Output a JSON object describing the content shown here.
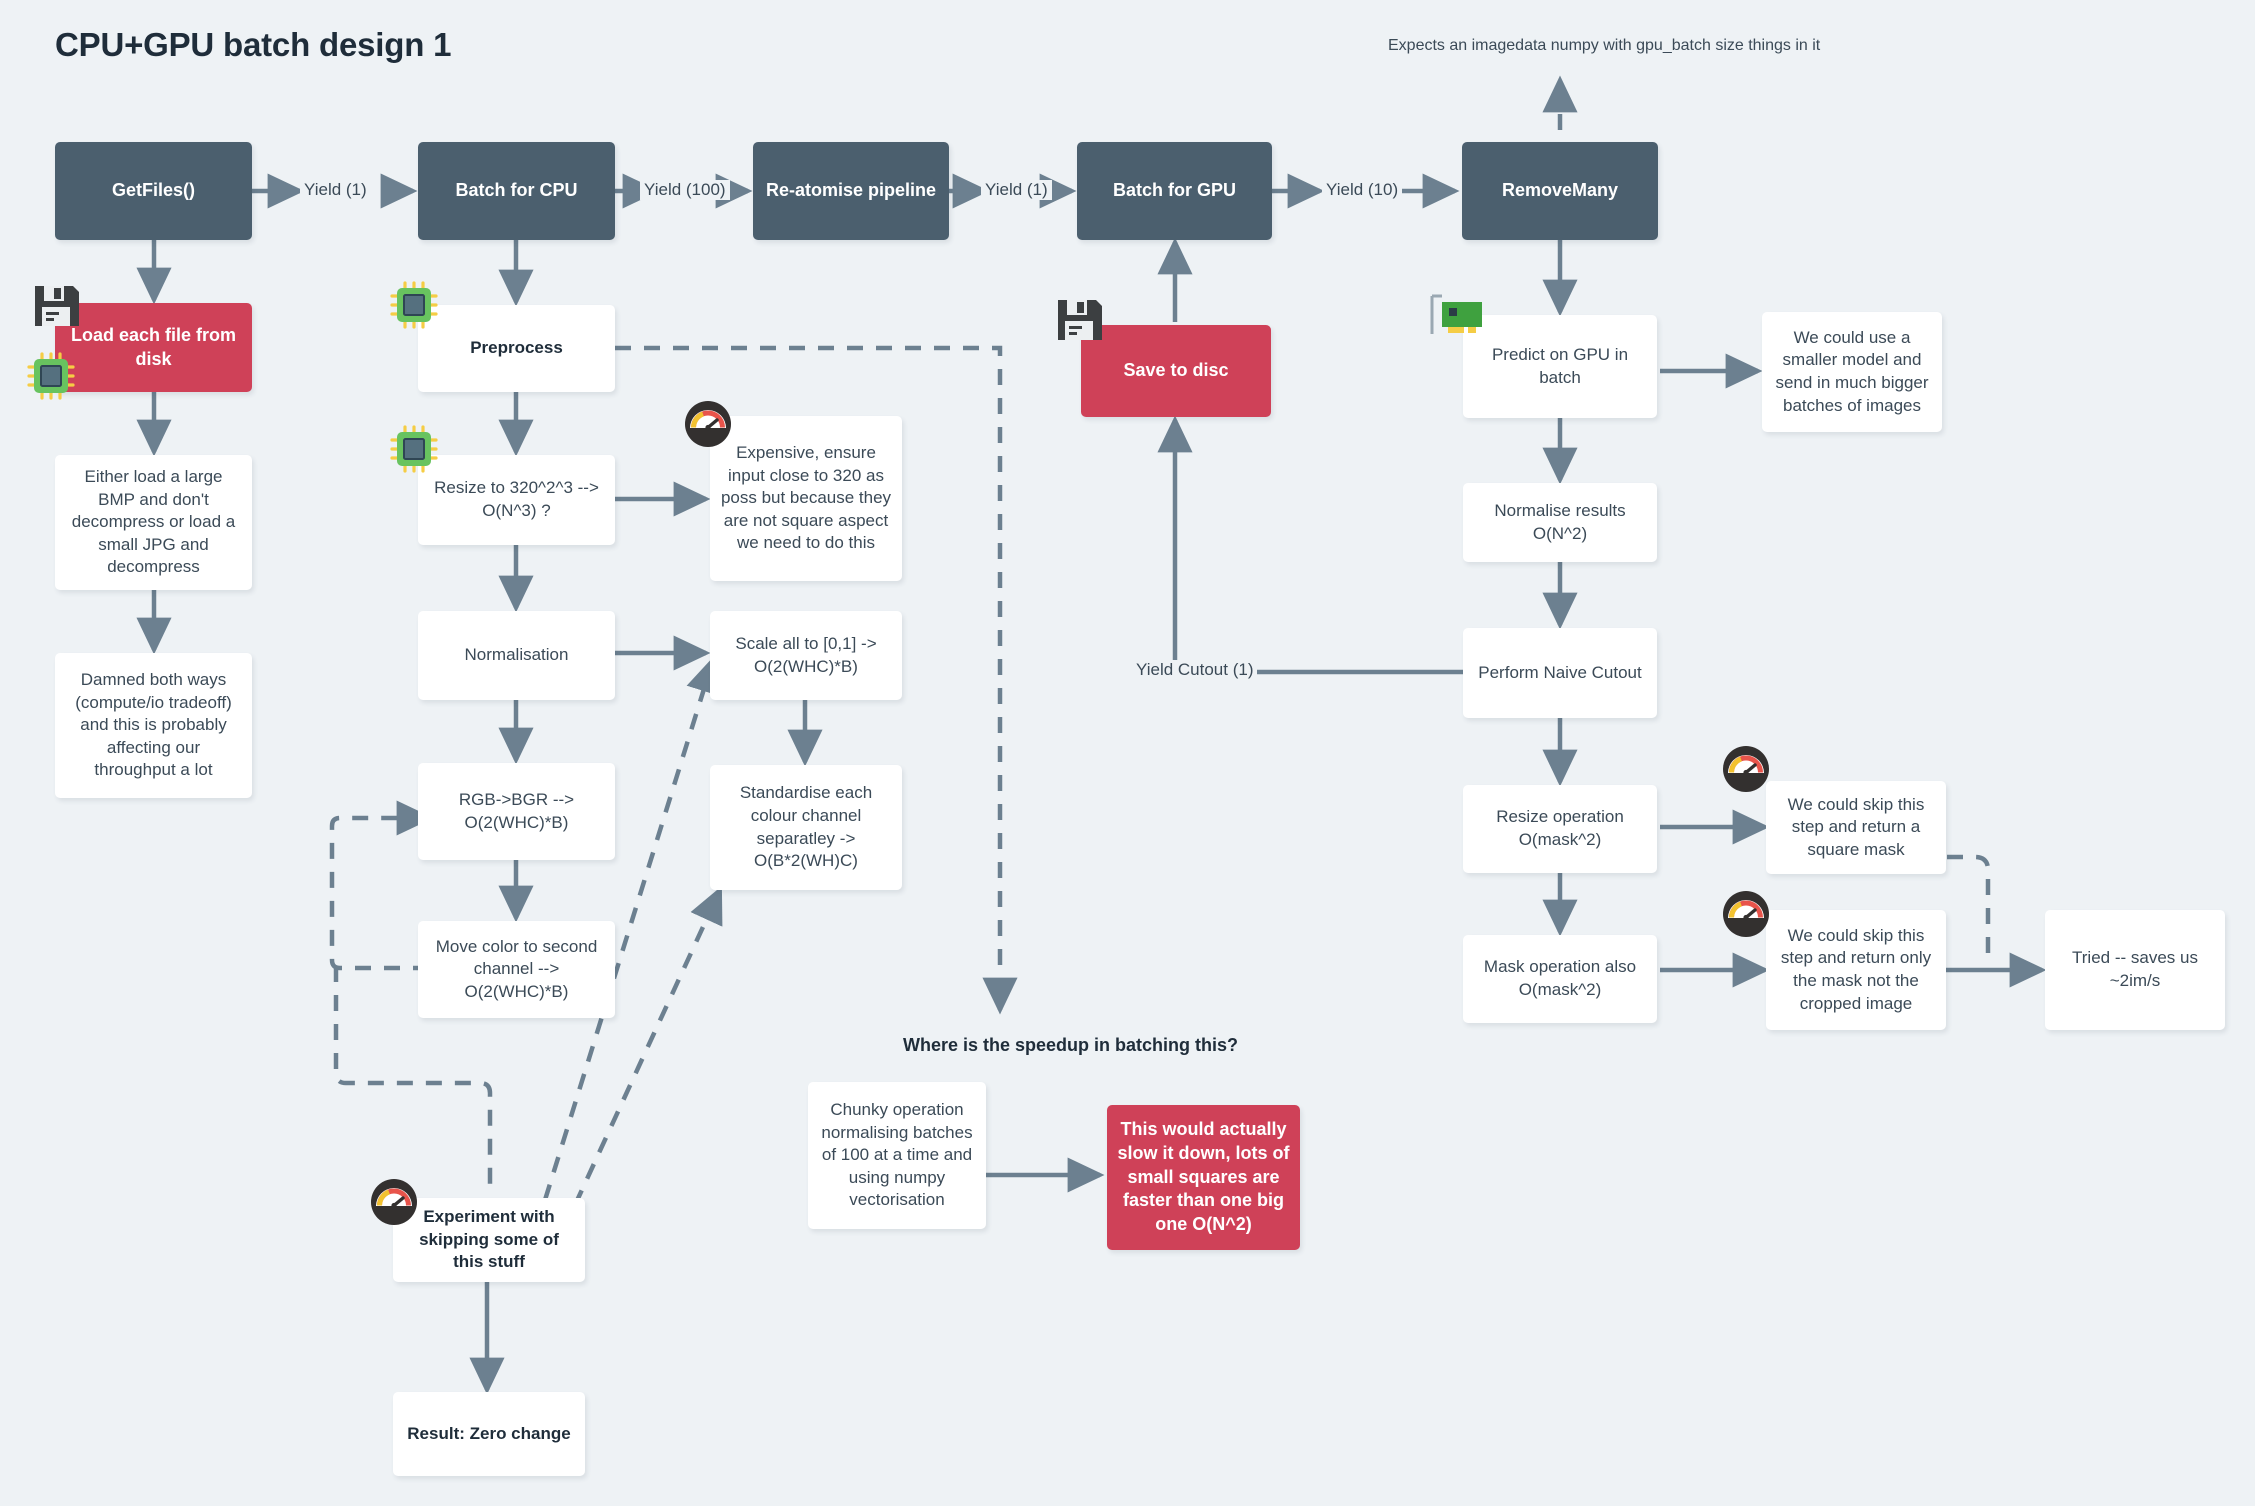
{
  "page": {
    "title": "CPU+GPU batch design 1",
    "background": "#eef2f5",
    "colors": {
      "dark_node": "#4b5f6e",
      "red_node": "#cf4158",
      "white_node": "#ffffff",
      "text": "#3b4a57",
      "wire": "#6c8090"
    }
  },
  "nodes": {
    "get_files": "GetFiles()",
    "batch_for_cpu": "Batch for CPU",
    "re_atomise": "Re-atomise pipeline",
    "batch_for_gpu": "Batch for GPU",
    "remove_many": "RemoveMany",
    "load_each_file": "Load each file from disk",
    "either_load": "Either load a large BMP and don't decompress or load a small JPG and decompress",
    "damned_both_ways": "Damned both ways (compute/io tradeoff) and this is probably affecting our throughput a lot",
    "preprocess": "Preprocess",
    "resize_320": "Resize to 320^2^3 --> O(N^3) ?",
    "normalisation": "Normalisation",
    "rgb_bgr": "RGB->BGR --> O(2(WHC)*B)",
    "move_color": "Move color to second channel --> O(2(WHC)*B)",
    "expensive_note": "Expensive, ensure input close to 320 as poss but because they are not square aspect we need to do this",
    "scale_all": "Scale all to [0,1] -> O(2(WHC)*B)",
    "standardise": "Standardise each colour channel separatley -> O(B*2(WH)C)",
    "experiment_skip": "Experiment with skipping some of this stuff",
    "result_zero_change": "Result: Zero change",
    "save_to_disc": "Save to disc",
    "chunky_operation": "Chunky operation normalising batches of 100 at a time and using numpy vectorisation",
    "would_slow_down": "This would actually slow it down, lots of small squares are faster than one big one O(N^2)",
    "predict_gpu": "Predict on GPU in batch",
    "smaller_model": "We could use a smaller model and send in much bigger batches of images",
    "normalise_results": "Normalise results O(N^2)",
    "perform_naive_cutout": "Perform Naive Cutout",
    "resize_operation": "Resize operation O(mask^2)",
    "mask_operation": "Mask operation also O(mask^2)",
    "skip_square_mask": "We could skip this step and return a square mask",
    "skip_only_mask": "We could skip this step and return only the mask not the cropped image",
    "tried_saves": "Tried -- saves us ~2im/s"
  },
  "edge_labels": {
    "yield_1_a": "Yield (1)",
    "yield_100": "Yield (100)",
    "yield_1_b": "Yield (1)",
    "yield_10": "Yield (10)",
    "yield_cutout_1": "Yield Cutout (1)"
  },
  "annotations": {
    "expects_imagedata": "Expects an imagedata numpy with gpu_batch size things in it",
    "where_speedup": "Where is the speedup in batching this?"
  },
  "icons": {
    "floppy_disk": "floppy-disk-icon",
    "cpu_chip": "cpu-chip-icon",
    "gpu_card": "gpu-card-icon",
    "gauge": "gauge-icon"
  }
}
